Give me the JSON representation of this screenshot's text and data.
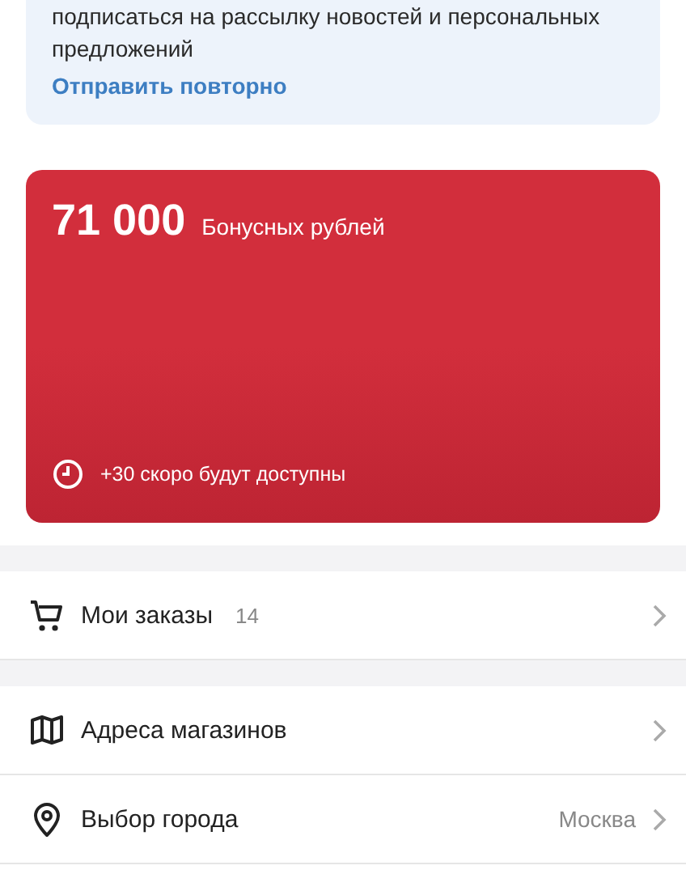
{
  "notice": {
    "text_lines": [
      "подписаться на рассылку новостей и персональных",
      "предложений"
    ],
    "link": "Отправить повторно"
  },
  "bonus": {
    "amount": "71 000",
    "label": "Бонусных рублей",
    "pending": "+30 скоро будут доступны"
  },
  "menu_groups": [
    [
      {
        "kind": "cart",
        "label": "Мои заказы",
        "count": "14"
      }
    ],
    [
      {
        "kind": "map",
        "label": "Адреса магазинов"
      },
      {
        "kind": "pin",
        "label": "Выбор города",
        "value": "Москва"
      }
    ]
  ]
}
